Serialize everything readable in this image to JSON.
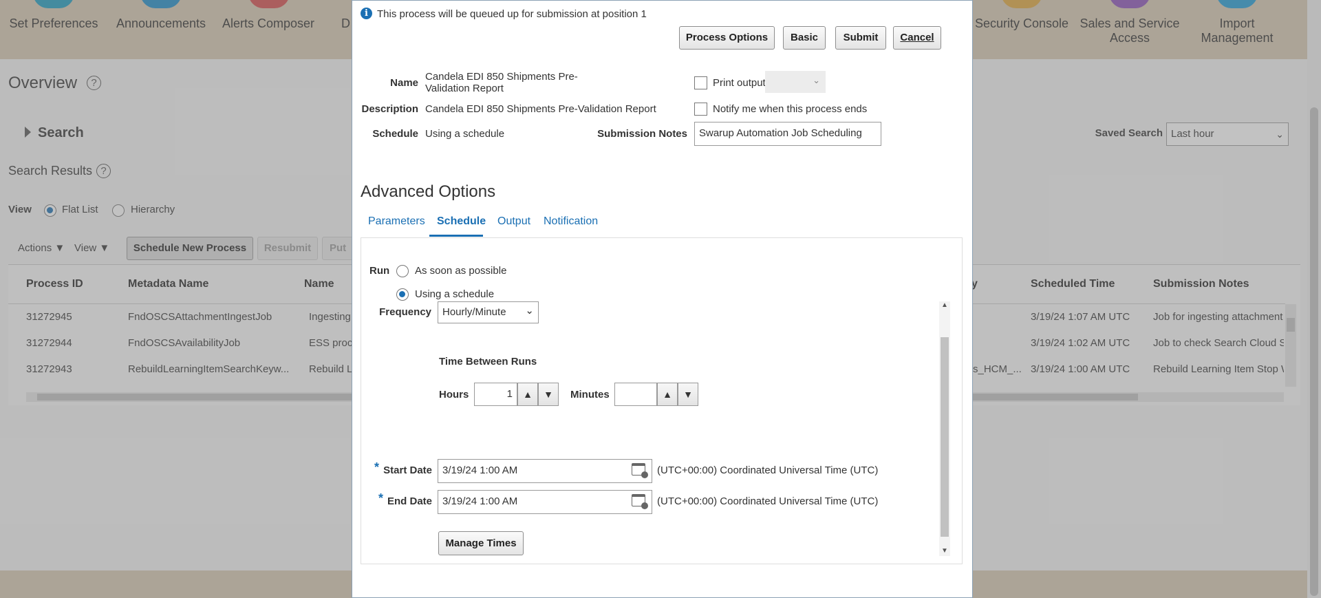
{
  "nav": {
    "items": [
      {
        "label": "Set Preferences",
        "color": "#1a9bbf"
      },
      {
        "label": "Announcements",
        "color": "#1a8bc9"
      },
      {
        "label": "Alerts Composer",
        "color": "#d64a4a"
      },
      {
        "label": "D",
        "color": "#5a5a5a"
      },
      {
        "label": "Security Console",
        "color": "#e0a63a"
      },
      {
        "label": "Sales and Service Access",
        "color": "#8a4fb8"
      },
      {
        "label": "Import Management",
        "color": "#1e9bd6"
      }
    ]
  },
  "page": {
    "title": "Overview",
    "search_label": "Search",
    "saved_search_label": "Saved Search",
    "saved_search_value": "Last hour",
    "results_title": "Search Results",
    "view_label": "View",
    "view_flat": "Flat List",
    "view_hierarchy": "Hierarchy",
    "toolbar": {
      "actions": "Actions",
      "view": "View",
      "schedule_new": "Schedule New Process",
      "resubmit": "Resubmit",
      "put": "Put"
    },
    "columns": [
      "Process ID",
      "Metadata Name",
      "Name",
      "y",
      "Scheduled Time",
      "Submission Notes"
    ],
    "rows": [
      {
        "id": "31272945",
        "meta": "FndOSCSAttachmentIngestJob",
        "name": "Ingesting",
        "extra": "",
        "time": "3/19/24 1:07 AM UTC",
        "notes": "Job for ingesting attachment"
      },
      {
        "id": "31272944",
        "meta": "FndOSCSAvailabilityJob",
        "name": "ESS proc",
        "extra": "",
        "time": "3/19/24 1:02 AM UTC",
        "notes": "Job to check Search Cloud S"
      },
      {
        "id": "31272943",
        "meta": "RebuildLearningItemSearchKeyw...",
        "name": "Rebuild L",
        "extra": "s_HCM_...",
        "time": "3/19/24 1:00 AM UTC",
        "notes": "Rebuild Learning Item Stop W"
      }
    ]
  },
  "dialog": {
    "info_text": "This process will be queued up for submission at position 1",
    "buttons": {
      "process_options": "Process Options",
      "basic": "Basic",
      "submit": "Submit",
      "cancel": "Cancel"
    },
    "name_label": "Name",
    "name_value_line1": "Candela EDI 850 Shipments Pre-",
    "name_value_line2": "Validation Report",
    "description_label": "Description",
    "description_value": "Candela EDI 850 Shipments Pre-Validation Report",
    "schedule_label": "Schedule",
    "schedule_value": "Using a schedule",
    "print_output_label": "Print output",
    "notify_label": "Notify me when this process ends",
    "submission_notes_label": "Submission Notes",
    "submission_notes_value": "Swarup Automation Job Scheduling",
    "advanced_title": "Advanced Options",
    "tabs": [
      "Parameters",
      "Schedule",
      "Output",
      "Notification"
    ],
    "active_tab": "Schedule",
    "run_label": "Run",
    "run_asap": "As soon as possible",
    "run_schedule": "Using a schedule",
    "frequency_label": "Frequency",
    "frequency_value": "Hourly/Minute",
    "time_between_label": "Time Between Runs",
    "hours_label": "Hours",
    "hours_value": "1",
    "minutes_label": "Minutes",
    "minutes_value": "",
    "required_mark": "*",
    "start_date_label": "Start Date",
    "start_date_value": "3/19/24 1:00 AM",
    "end_date_label": "End Date",
    "end_date_value": "3/19/24 1:00 AM",
    "timezone_text": "(UTC+00:00) Coordinated Universal Time (UTC)",
    "manage_times": "Manage Times"
  },
  "colors": {
    "band": "#d7c8b1",
    "link": "#1a6fb3",
    "overlay": "rgba(120,120,120,0.45)"
  }
}
